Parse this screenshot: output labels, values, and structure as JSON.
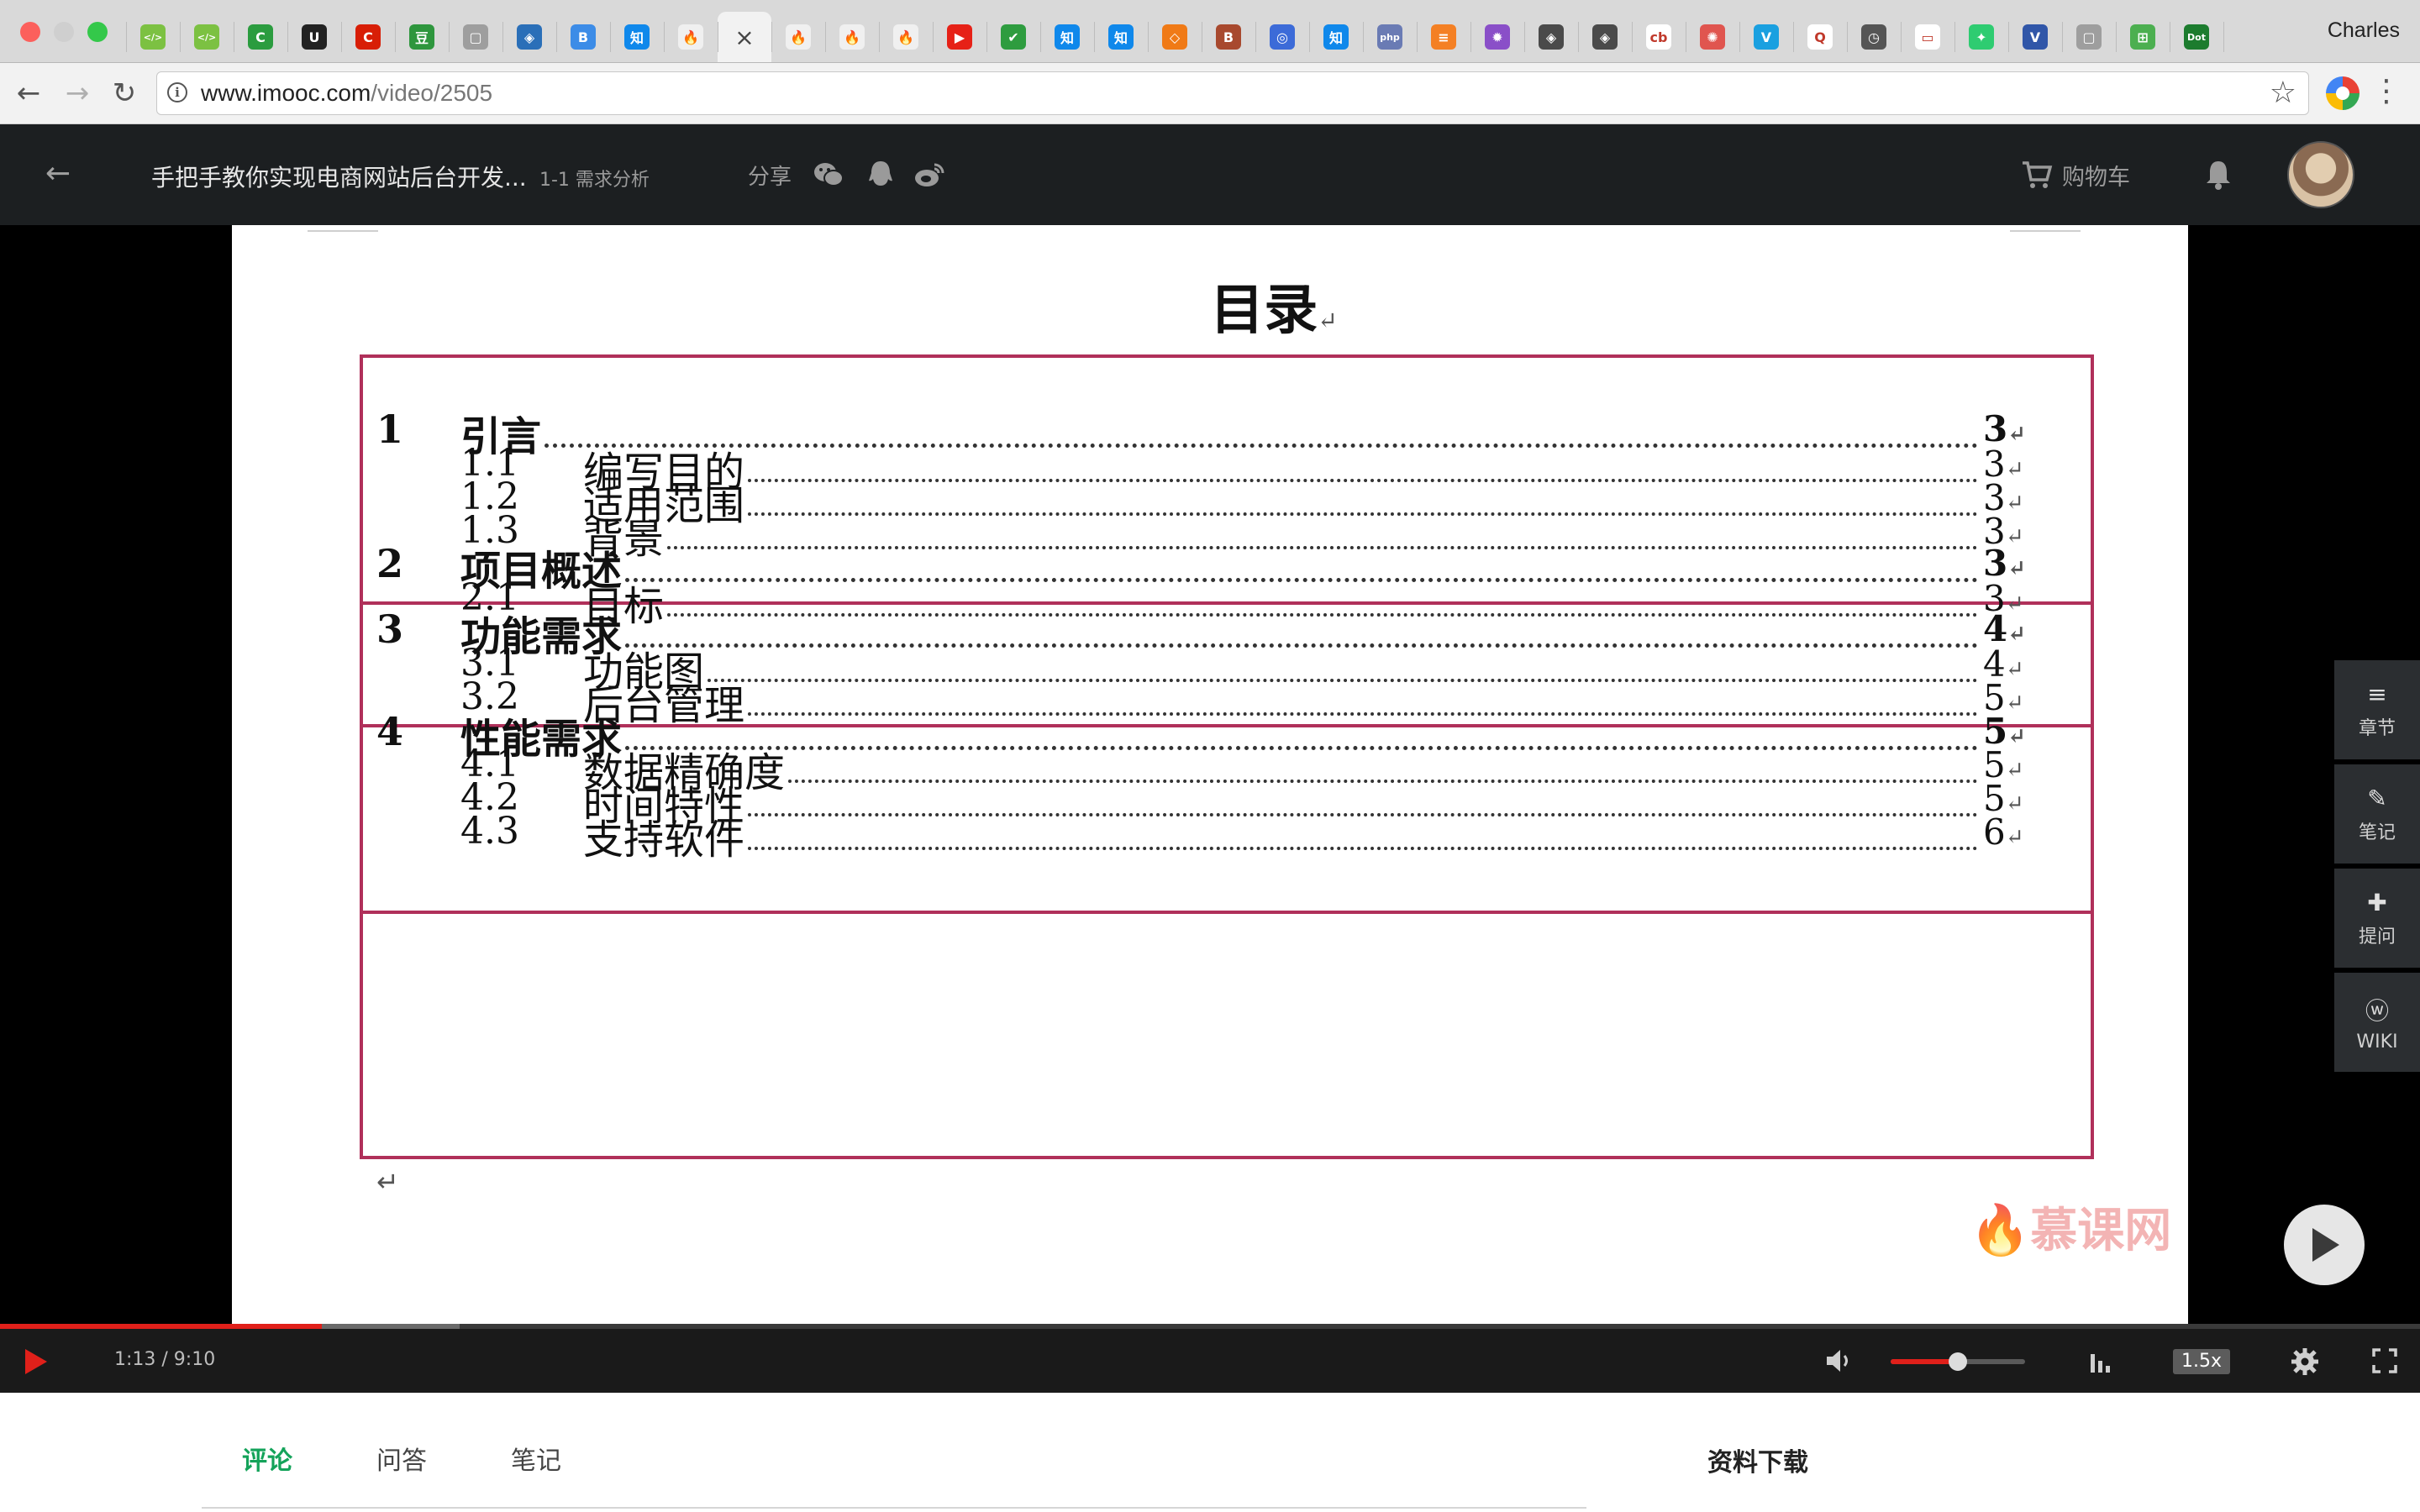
{
  "browser": {
    "profile_name": "Charles",
    "url_host": "www.imooc.com",
    "url_path": "/video/2505",
    "tab_close_glyph": "×",
    "tabs": [
      {
        "name": "tab-codepen",
        "glyph": "</>",
        "color": "#7cc142"
      },
      {
        "name": "tab-codepen-2",
        "glyph": "</>",
        "color": "#7cc142"
      },
      {
        "name": "tab-c",
        "glyph": "C",
        "color": "#2b9c3f"
      },
      {
        "name": "tab-u",
        "glyph": "U",
        "color": "#222222"
      },
      {
        "name": "tab-csdn",
        "glyph": "C",
        "color": "#d81e06"
      },
      {
        "name": "tab-douban",
        "glyph": "豆",
        "color": "#2e963d"
      },
      {
        "name": "tab-doc",
        "glyph": "▢",
        "color": "#9e9e9e"
      },
      {
        "name": "tab-blue",
        "glyph": "◈",
        "color": "#2a6fb8"
      },
      {
        "name": "tab-b",
        "glyph": "B",
        "color": "#3c8ce7"
      },
      {
        "name": "tab-zhihu",
        "glyph": "知",
        "color": "#0f88eb"
      },
      {
        "name": "tab-imooc",
        "glyph": "🔥",
        "color": "#f0f0f0"
      },
      {
        "name": "tab-active",
        "glyph": "×",
        "color": "#f2f2f2"
      },
      {
        "name": "tab-imooc-2",
        "glyph": "🔥",
        "color": "#f0f0f0"
      },
      {
        "name": "tab-imooc-3",
        "glyph": "🔥",
        "color": "#f0f0f0"
      },
      {
        "name": "tab-imooc-4",
        "glyph": "🔥",
        "color": "#f0f0f0"
      },
      {
        "name": "tab-youtube",
        "glyph": "▶",
        "color": "#e62117"
      },
      {
        "name": "tab-check",
        "glyph": "✔",
        "color": "#2e9c3f"
      },
      {
        "name": "tab-zhihu-2",
        "glyph": "知",
        "color": "#0f88eb"
      },
      {
        "name": "tab-zhihu-3",
        "glyph": "知",
        "color": "#0f88eb"
      },
      {
        "name": "tab-orange",
        "glyph": "◇",
        "color": "#f07a16"
      },
      {
        "name": "tab-b3",
        "glyph": "B",
        "color": "#a8492e"
      },
      {
        "name": "tab-circle",
        "glyph": "◎",
        "color": "#3c6bd8"
      },
      {
        "name": "tab-zhihu-4",
        "glyph": "知",
        "color": "#0f88eb"
      },
      {
        "name": "tab-php",
        "glyph": "php",
        "color": "#6a7bb4"
      },
      {
        "name": "tab-stack",
        "glyph": "≡",
        "color": "#f48024"
      },
      {
        "name": "tab-php-2",
        "glyph": "✹",
        "color": "#8a4fc8"
      },
      {
        "name": "tab-diamond",
        "glyph": "◈",
        "color": "#4a4a4a"
      },
      {
        "name": "tab-diamond-2",
        "glyph": "◈",
        "color": "#4a4a4a"
      },
      {
        "name": "tab-cb",
        "glyph": "cb",
        "color": "#ffffff"
      },
      {
        "name": "tab-swirl",
        "glyph": "✺",
        "color": "#e0554f"
      },
      {
        "name": "tab-v",
        "glyph": "V",
        "color": "#1aa0e0"
      },
      {
        "name": "tab-q",
        "glyph": "Q",
        "color": "#ffffff"
      },
      {
        "name": "tab-clock",
        "glyph": "◷",
        "color": "#555555"
      },
      {
        "name": "tab-white",
        "glyph": "▭",
        "color": "#ffffff"
      },
      {
        "name": "tab-spark",
        "glyph": "✦",
        "color": "#2ecc71"
      },
      {
        "name": "tab-v2",
        "glyph": "V",
        "color": "#3056a8"
      },
      {
        "name": "tab-doc-2",
        "glyph": "▢",
        "color": "#9e9e9e"
      },
      {
        "name": "tab-green",
        "glyph": "⊞",
        "color": "#4caf50"
      },
      {
        "name": "tab-dot",
        "glyph": "Dot",
        "color": "#1c7c2e"
      },
      {
        "name": "tab-new",
        "glyph": "",
        "color": "#d9d9d9"
      }
    ]
  },
  "header": {
    "course_title": "手把手教你实现电商网站后台开发...",
    "lesson": "1-1 需求分析",
    "share_label": "分享",
    "cart_label": "购物车"
  },
  "slide": {
    "title": "目录",
    "return_mark": "↵",
    "watermark": "慕课网",
    "entries": [
      {
        "level": 1,
        "num": "1",
        "label": "引言",
        "page": "3"
      },
      {
        "level": 2,
        "num": "1.1",
        "label": "编写目的",
        "page": "3"
      },
      {
        "level": 2,
        "num": "1.2",
        "label": "适用范围",
        "page": "3"
      },
      {
        "level": 2,
        "num": "1.3",
        "label": "背景",
        "page": "3"
      },
      {
        "level": 1,
        "num": "2",
        "label": "项目概述",
        "page": "3"
      },
      {
        "level": 2,
        "num": "2.1",
        "label": "目标",
        "page": "3"
      },
      {
        "level": 1,
        "num": "3",
        "label": "功能需求",
        "page": "4"
      },
      {
        "level": 2,
        "num": "3.1",
        "label": "功能图",
        "page": "4"
      },
      {
        "level": 2,
        "num": "3.2",
        "label": "后台管理",
        "page": "5"
      },
      {
        "level": 1,
        "num": "4",
        "label": "性能需求",
        "page": "5"
      },
      {
        "level": 2,
        "num": "4.1",
        "label": "数据精确度",
        "page": "5"
      },
      {
        "level": 2,
        "num": "4.2",
        "label": "时间特性",
        "page": "5"
      },
      {
        "level": 2,
        "num": "4.3",
        "label": "支持软件",
        "page": "6"
      }
    ]
  },
  "side_tools": [
    {
      "name": "chapters",
      "label": "章节",
      "icon": "≡"
    },
    {
      "name": "notes",
      "label": "笔记",
      "icon": "✎"
    },
    {
      "name": "ask",
      "label": "提问",
      "icon": "✚"
    },
    {
      "name": "wiki",
      "label": "WIKI",
      "icon": "ⓦ"
    }
  ],
  "player": {
    "time": "1:13 / 9:10",
    "played_fraction": 0.133,
    "buffered_fraction": 0.19,
    "volume_fraction": 0.5,
    "speed": "1.5x",
    "accent_color": "#e0201a"
  },
  "bottom_tabs": [
    {
      "label": "评论",
      "active": true
    },
    {
      "label": "问答",
      "active": false
    },
    {
      "label": "笔记",
      "active": false
    }
  ],
  "downloads_label": "资料下载"
}
